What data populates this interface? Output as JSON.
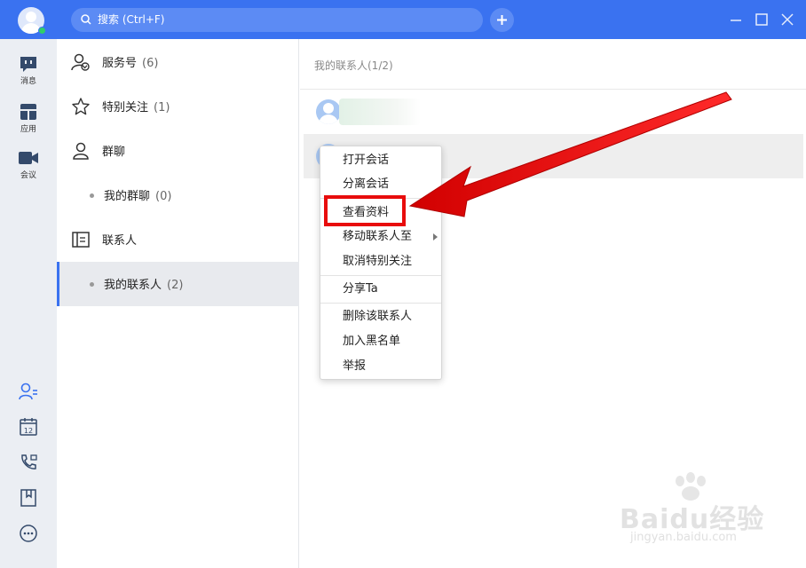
{
  "titlebar": {
    "search_placeholder": "搜索 (Ctrl+F)"
  },
  "leftnav": {
    "items": [
      {
        "label": "消息",
        "icon": "message-icon"
      },
      {
        "label": "应用",
        "icon": "apps-icon"
      },
      {
        "label": "会议",
        "icon": "video-meeting-icon"
      }
    ],
    "bottom_icons": [
      "contacts-icon",
      "calendar-icon",
      "phone-icon",
      "bookmark-icon",
      "more-icon"
    ],
    "calendar_day": "12"
  },
  "contacts_categories": [
    {
      "label": "服务号",
      "count": "(6)"
    },
    {
      "label": "特别关注",
      "count": "(1)"
    },
    {
      "label": "群聊",
      "count": ""
    },
    {
      "label": "我的群聊",
      "count": "(0)"
    },
    {
      "label": "联系人",
      "count": ""
    },
    {
      "label": "我的联系人",
      "count": "(2)"
    }
  ],
  "right_panel": {
    "header": "我的联系人(1/2)"
  },
  "context_menu": {
    "items": [
      "打开会话",
      "分离会话",
      "查看资料",
      "移动联系人至",
      "取消特别关注",
      "分享Ta",
      "删除该联系人",
      "加入黑名单",
      "举报"
    ]
  },
  "watermark": {
    "brand": "Baidu经验",
    "url": "jingyan.baidu.com"
  },
  "colors": {
    "accent": "#3a72f0",
    "highlight": "#e80c0c",
    "online": "#2fce6a"
  }
}
